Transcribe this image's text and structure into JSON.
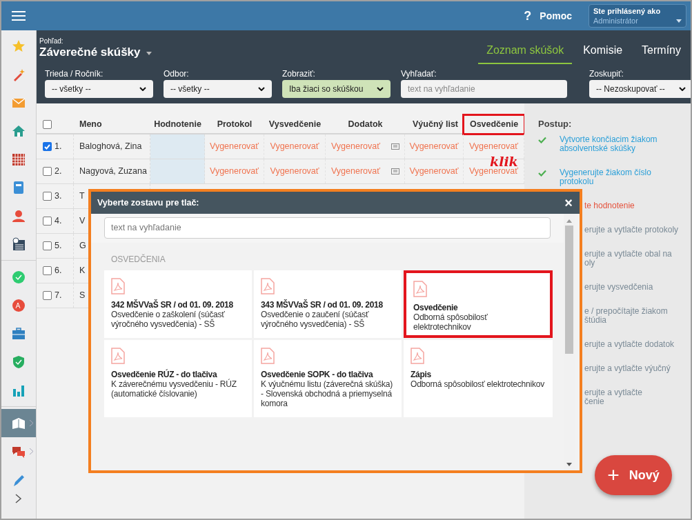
{
  "topbar": {
    "help": "?",
    "help_label": "Pomoc",
    "user_label": "Ste prihlásený ako",
    "user_name": "Administrátor"
  },
  "sidebar": {
    "items": [
      {
        "selected": false
      },
      {
        "selected": false
      },
      {
        "selected": false
      },
      {
        "selected": false
      },
      {
        "selected": false
      },
      {
        "selected": false
      },
      {
        "selected": false
      },
      {
        "selected": false
      },
      {
        "selected": false
      },
      {
        "selected": false
      },
      {
        "selected": false
      },
      {
        "selected": false
      },
      {
        "selected": false
      },
      {
        "selected": true
      },
      {
        "selected": false
      },
      {
        "selected": false
      }
    ]
  },
  "view": {
    "label": "Pohľad:",
    "title": "Záverečné skúšky"
  },
  "tabs": [
    {
      "label": "Zoznam skúšok",
      "selected": true
    },
    {
      "label": "Komisie",
      "selected": false
    },
    {
      "label": "Termíny",
      "selected": false
    }
  ],
  "filters": [
    {
      "label": "Trieda / Ročník:",
      "kind": "select",
      "value": "-- všetky --",
      "active": false
    },
    {
      "label": "Odbor:",
      "kind": "select",
      "value": "-- všetky --",
      "active": false
    },
    {
      "label": "Zobraziť:",
      "kind": "select",
      "value": "Iba žiaci so skúškou",
      "active": true
    },
    {
      "label": "Vyhľadať:",
      "kind": "search",
      "placeholder": "text na vyhľadanie",
      "active": false
    },
    {
      "label": "Zoskupiť:",
      "kind": "select",
      "value": "-- Nezoskupovať --",
      "active": false
    }
  ],
  "table": {
    "columns": [
      {
        "label": "Meno",
        "highlighted": false
      },
      {
        "label": "Hodnotenie",
        "highlighted": false
      },
      {
        "label": "Protokol",
        "highlighted": false
      },
      {
        "label": "Vysvedčenie",
        "highlighted": false
      },
      {
        "label": "Dodatok",
        "highlighted": false
      },
      {
        "label": "Výučný list",
        "highlighted": false
      },
      {
        "label": "Osvedčenie",
        "highlighted": true
      }
    ],
    "rows": [
      {
        "number": "1.",
        "name": "Baloghová, Zina",
        "checked": true,
        "cells": [
          "Vygenerovať",
          "Vygenerovať",
          "Vygenerovať",
          "Vygenerovať",
          "Vygenerovať"
        ]
      },
      {
        "number": "2.",
        "name": "Nagyová, Zuzana",
        "checked": false,
        "cells": [
          "Vygenerovať",
          "Vygenerovať",
          "Vygenerovať",
          "Vygenerovať",
          "Vygenerovať"
        ]
      },
      {
        "number": "3.",
        "name": "T",
        "checked": false
      },
      {
        "number": "4.",
        "name": "V",
        "checked": false
      },
      {
        "number": "5.",
        "name": "G",
        "checked": false
      },
      {
        "number": "6.",
        "name": "K",
        "checked": false
      },
      {
        "number": "7.",
        "name": "S",
        "checked": false
      }
    ],
    "select_all": {
      "checked": false
    }
  },
  "annotation": "klik",
  "steps": {
    "title": "Postup:",
    "items": [
      {
        "lines": [
          "Vytvorte končiacim žiakom",
          "absolventské skúšky"
        ],
        "done": true,
        "current": false,
        "kind": "full"
      },
      {
        "lines": [
          "Vygenerujte žiakom číslo",
          "protokolu"
        ],
        "done": true,
        "current": false,
        "kind": "full"
      },
      {
        "lines": [
          "te hodnotenie"
        ],
        "done": false,
        "current": true,
        "kind": "partial"
      },
      {
        "lines": [
          "erujte a vytlačte protokoly"
        ],
        "done": false,
        "current": false,
        "kind": "partial"
      },
      {
        "lines": [
          "erujte a vytlačte obal na",
          "oly"
        ],
        "done": false,
        "current": false,
        "kind": "partial"
      },
      {
        "lines": [
          "erujte vysvedčenia"
        ],
        "done": false,
        "current": false,
        "kind": "partial"
      },
      {
        "lines": [
          "e / prepočítajte žiakom",
          "štúdia"
        ],
        "done": false,
        "current": false,
        "kind": "partial"
      },
      {
        "lines": [
          "erujte a vytlačte dodatok"
        ],
        "done": false,
        "current": false,
        "kind": "partial"
      },
      {
        "lines": [
          "erujte a vytlačte výučný"
        ],
        "done": false,
        "current": false,
        "kind": "partial"
      },
      {
        "lines": [
          "erujte a vytlačte",
          "čenie"
        ],
        "done": false,
        "current": false,
        "kind": "partial"
      }
    ]
  },
  "fab": {
    "icon": "+",
    "label": "Nový"
  },
  "modal": {
    "title": "Vyberte zostavu pre tlač:",
    "close": "×",
    "search_placeholder": "text na vyhľadanie",
    "section": "OSVEDČENIA",
    "cards": [
      {
        "title": "342 MŠVVaŠ SR / od 01. 09. 2018",
        "description": "Osvedčenie o zaškolení (súčasť výročného vysvedčenia) - SŠ",
        "highlighted": false
      },
      {
        "title": "343 MŠVVaŠ SR / od 01. 09. 2018",
        "description": "Osvedčenie o zaučení (súčasť výročného vysvedčenia) - SŠ",
        "highlighted": false
      },
      {
        "title": "Osvedčenie",
        "description": "Odborná spôsobilosť elektrotechnikov",
        "highlighted": true
      },
      {
        "title": "Osvedčenie RÚZ - do tlačiva",
        "description": "K záverečnému vysvedčeniu - RÚZ (automatické číslovanie)",
        "highlighted": false
      },
      {
        "title": "Osvedčenie SOPK - do tlačiva",
        "description": "K výučnému listu (záverečná skúška) - Slovenská obchodná a priemyselná komora",
        "highlighted": false
      },
      {
        "title": "Zápis",
        "description": "Odborná spôsobilosť elektrotechnikov",
        "highlighted": false
      }
    ]
  }
}
